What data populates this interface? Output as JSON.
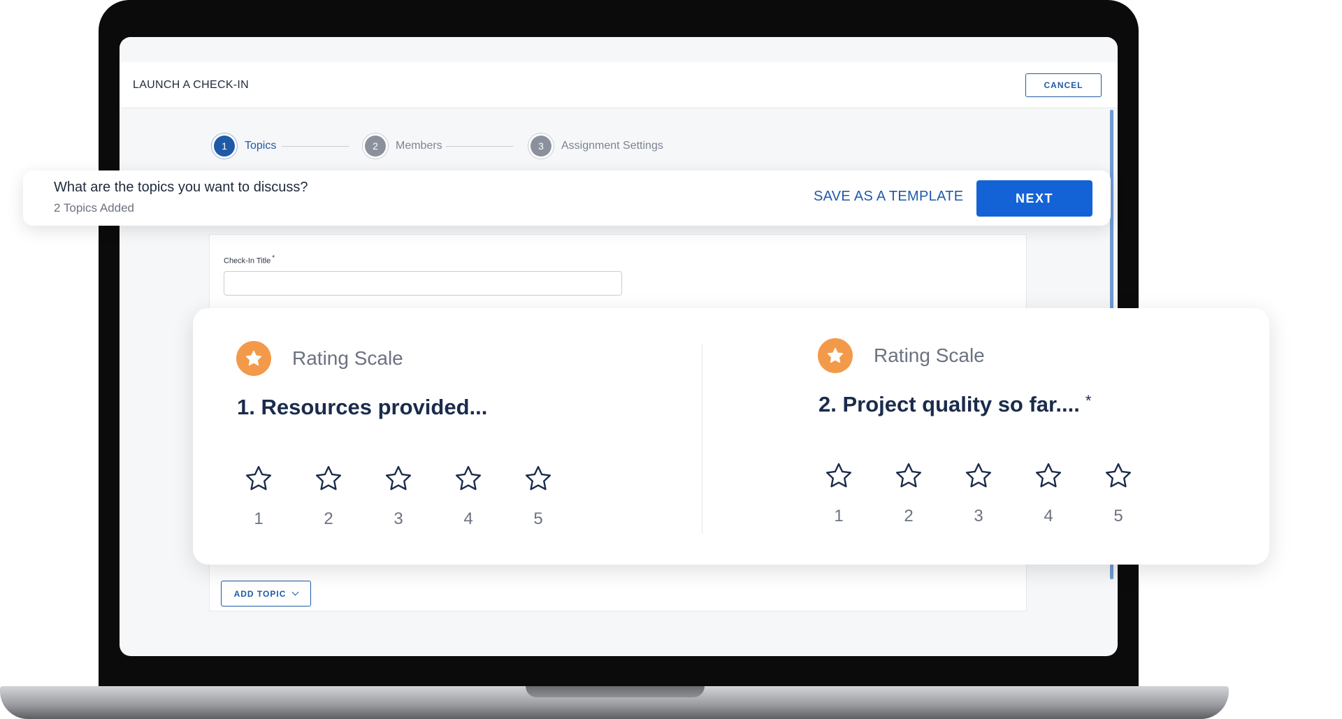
{
  "header": {
    "title": "LAUNCH A CHECK-IN",
    "cancel_label": "CANCEL"
  },
  "stepper": [
    {
      "number": "1",
      "label": "Topics",
      "state": "active"
    },
    {
      "number": "2",
      "label": "Members",
      "state": "inactive"
    },
    {
      "number": "3",
      "label": "Assignment Settings",
      "state": "inactive"
    }
  ],
  "topbar": {
    "question": "What are the topics you want to discuss?",
    "topics_count": "2 Topics Added",
    "save_template_label": "SAVE AS A TEMPLATE",
    "next_label": "NEXT"
  },
  "form": {
    "title_label": "Check-In Title",
    "required_mark": "*",
    "title_value": "",
    "add_topic_label": "ADD TOPIC"
  },
  "topics": [
    {
      "type_label": "Rating Scale",
      "title": "1. Resources provided...",
      "required": "",
      "scale": [
        "1",
        "2",
        "3",
        "4",
        "5"
      ]
    },
    {
      "type_label": "Rating Scale",
      "title": "2. Project quality so far....",
      "required": "*",
      "scale": [
        "1",
        "2",
        "3",
        "4",
        "5"
      ]
    }
  ],
  "colors": {
    "primary": "#1f5aa6",
    "next_button": "#1463d6",
    "badge": "#f39a4a",
    "heading": "#1a2b4c"
  },
  "icons": {
    "badge": "star-icon",
    "rating": "star-outline-icon",
    "dropdown": "chevron-down-icon"
  }
}
